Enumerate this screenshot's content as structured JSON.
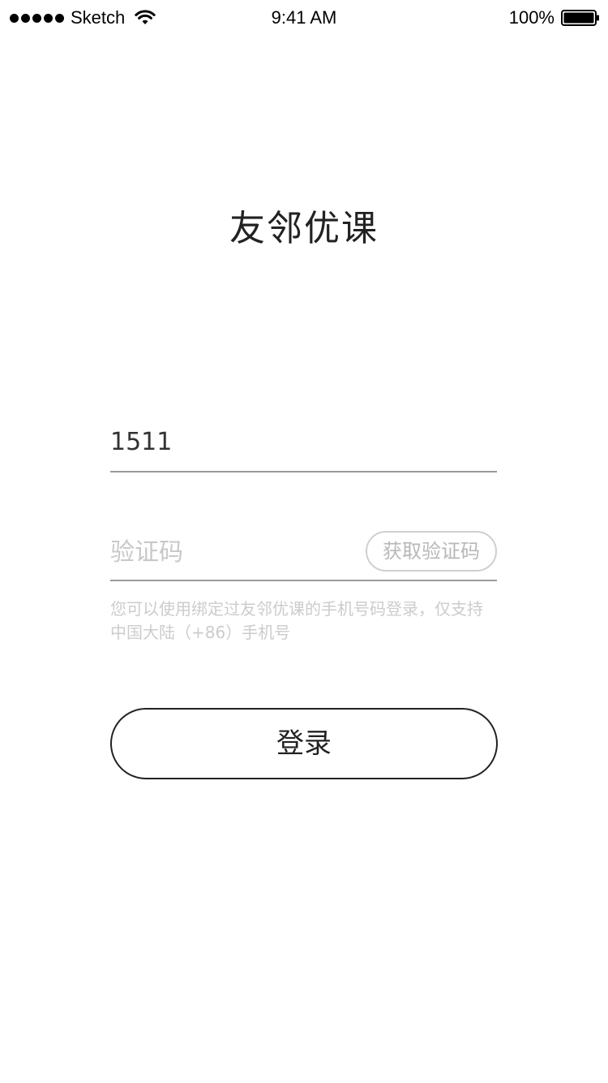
{
  "status_bar": {
    "carrier": "Sketch",
    "time": "9:41 AM",
    "battery_percent": "100%",
    "signal_icon": "signal-dots-icon",
    "wifi_icon": "wifi-icon",
    "battery_icon": "battery-full-icon"
  },
  "app": {
    "title": "友邻优课"
  },
  "login_form": {
    "phone_value": "1511",
    "code_placeholder": "验证码",
    "get_code_label": "获取验证码",
    "hint": "您可以使用绑定过友邻优课的手机号码登录，仅支持中国大陆（+86）手机号",
    "login_label": "登录"
  },
  "colors": {
    "text_primary": "#222222",
    "placeholder": "#c8c8c8",
    "divider": "#9a9a9a",
    "hint": "#cccccc",
    "background": "#ffffff"
  }
}
